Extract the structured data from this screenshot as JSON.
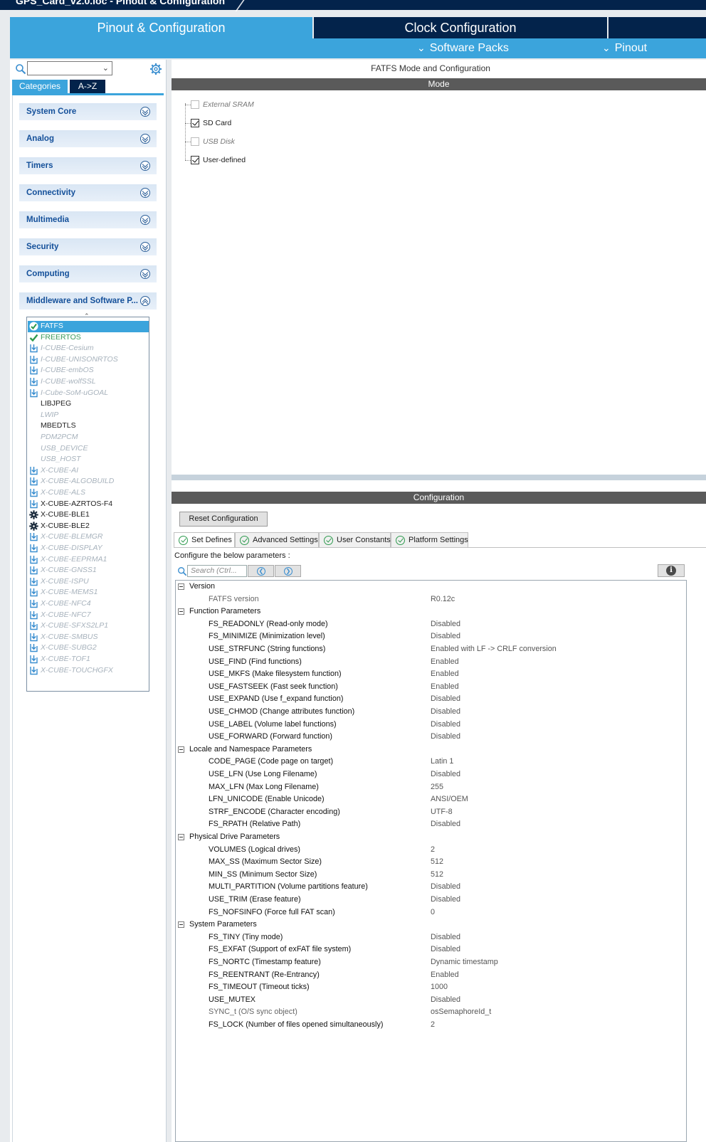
{
  "window": {
    "title": "GPS_Card_v2.0.ioc - Pinout & Configuration"
  },
  "top_tabs": {
    "pinout": "Pinout & Configuration",
    "clock": "Clock Configuration"
  },
  "sub_menu": {
    "software_packs": "Software Packs",
    "pinout": "Pinout"
  },
  "left_panel": {
    "search_value": "",
    "tabs": {
      "categories": "Categories",
      "az": "A->Z"
    },
    "categories": [
      "System Core",
      "Analog",
      "Timers",
      "Connectivity",
      "Multimedia",
      "Security",
      "Computing",
      "Middleware and Software P..."
    ],
    "middleware_items": [
      {
        "label": "FATFS",
        "state": "selected",
        "icon": "check-icon"
      },
      {
        "label": "FREERTOS",
        "state": "enabled",
        "icon": "check-icon"
      },
      {
        "label": "I-CUBE-Cesium",
        "state": "disabled",
        "icon": "download-icon"
      },
      {
        "label": "I-CUBE-UNISONRTOS",
        "state": "disabled",
        "icon": "download-icon"
      },
      {
        "label": "I-CUBE-embOS",
        "state": "disabled",
        "icon": "download-icon"
      },
      {
        "label": "I-CUBE-wolfSSL",
        "state": "disabled",
        "icon": "download-icon"
      },
      {
        "label": "I-Cube-SoM-uGOAL",
        "state": "disabled",
        "icon": "download-icon"
      },
      {
        "label": "LIBJPEG",
        "state": "normal",
        "icon": ""
      },
      {
        "label": "LWIP",
        "state": "disabled",
        "icon": ""
      },
      {
        "label": "MBEDTLS",
        "state": "normal",
        "icon": ""
      },
      {
        "label": "PDM2PCM",
        "state": "disabled",
        "icon": ""
      },
      {
        "label": "USB_DEVICE",
        "state": "disabled",
        "icon": ""
      },
      {
        "label": "USB_HOST",
        "state": "disabled",
        "icon": ""
      },
      {
        "label": "X-CUBE-AI",
        "state": "disabled",
        "icon": "download-icon"
      },
      {
        "label": "X-CUBE-ALGOBUILD",
        "state": "disabled",
        "icon": "download-icon"
      },
      {
        "label": "X-CUBE-ALS",
        "state": "disabled",
        "icon": "download-icon"
      },
      {
        "label": "X-CUBE-AZRTOS-F4",
        "state": "normal",
        "icon": "download-icon"
      },
      {
        "label": "X-CUBE-BLE1",
        "state": "normal",
        "icon": "gear-icon"
      },
      {
        "label": "X-CUBE-BLE2",
        "state": "normal",
        "icon": "gear-icon"
      },
      {
        "label": "X-CUBE-BLEMGR",
        "state": "disabled",
        "icon": "download-icon"
      },
      {
        "label": "X-CUBE-DISPLAY",
        "state": "disabled",
        "icon": "download-icon"
      },
      {
        "label": "X-CUBE-EEPRMA1",
        "state": "disabled",
        "icon": "download-icon"
      },
      {
        "label": "X-CUBE-GNSS1",
        "state": "disabled",
        "icon": "download-icon"
      },
      {
        "label": "X-CUBE-ISPU",
        "state": "disabled",
        "icon": "download-icon"
      },
      {
        "label": "X-CUBE-MEMS1",
        "state": "disabled",
        "icon": "download-icon"
      },
      {
        "label": "X-CUBE-NFC4",
        "state": "disabled",
        "icon": "download-icon"
      },
      {
        "label": "X-CUBE-NFC7",
        "state": "disabled",
        "icon": "download-icon"
      },
      {
        "label": "X-CUBE-SFXS2LP1",
        "state": "disabled",
        "icon": "download-icon"
      },
      {
        "label": "X-CUBE-SMBUS",
        "state": "disabled",
        "icon": "download-icon"
      },
      {
        "label": "X-CUBE-SUBG2",
        "state": "disabled",
        "icon": "download-icon"
      },
      {
        "label": "X-CUBE-TOF1",
        "state": "disabled",
        "icon": "download-icon"
      },
      {
        "label": "X-CUBE-TOUCHGFX",
        "state": "disabled",
        "icon": "download-icon"
      }
    ]
  },
  "mode_panel": {
    "title": "FATFS Mode and Configuration",
    "header": "Mode",
    "options": [
      {
        "label": "External SRAM",
        "checked": false,
        "enabled": false
      },
      {
        "label": "SD Card",
        "checked": true,
        "enabled": true
      },
      {
        "label": "USB Disk",
        "checked": false,
        "enabled": false
      },
      {
        "label": "User-defined",
        "checked": true,
        "enabled": true
      }
    ]
  },
  "config_panel": {
    "header": "Configuration",
    "reset_label": "Reset Configuration",
    "tabs": [
      "Set Defines",
      "Advanced Settings",
      "User Constants",
      "Platform Settings"
    ],
    "hint": "Configure the below parameters :",
    "search_placeholder": "Search (Ctrl...",
    "groups": [
      {
        "name": "Version",
        "params": [
          {
            "name": "FATFS version",
            "value": "R0.12c",
            "gray": true
          }
        ]
      },
      {
        "name": "Function Parameters",
        "params": [
          {
            "name": "FS_READONLY (Read-only mode)",
            "value": "Disabled"
          },
          {
            "name": "FS_MINIMIZE (Minimization level)",
            "value": "Disabled"
          },
          {
            "name": "USE_STRFUNC (String functions)",
            "value": "Enabled with LF -> CRLF conversion"
          },
          {
            "name": "USE_FIND (Find functions)",
            "value": "Enabled"
          },
          {
            "name": "USE_MKFS (Make filesystem function)",
            "value": "Enabled"
          },
          {
            "name": "USE_FASTSEEK (Fast seek function)",
            "value": "Enabled"
          },
          {
            "name": "USE_EXPAND (Use f_expand function)",
            "value": "Disabled"
          },
          {
            "name": "USE_CHMOD (Change attributes function)",
            "value": "Disabled"
          },
          {
            "name": "USE_LABEL (Volume label functions)",
            "value": "Disabled"
          },
          {
            "name": "USE_FORWARD (Forward function)",
            "value": "Disabled"
          }
        ]
      },
      {
        "name": "Locale and Namespace Parameters",
        "params": [
          {
            "name": "CODE_PAGE (Code page on target)",
            "value": "Latin 1"
          },
          {
            "name": "USE_LFN (Use Long Filename)",
            "value": "Disabled"
          },
          {
            "name": "MAX_LFN (Max Long Filename)",
            "value": "255"
          },
          {
            "name": "LFN_UNICODE (Enable Unicode)",
            "value": "ANSI/OEM"
          },
          {
            "name": "STRF_ENCODE (Character encoding)",
            "value": "UTF-8"
          },
          {
            "name": "FS_RPATH (Relative Path)",
            "value": "Disabled"
          }
        ]
      },
      {
        "name": "Physical Drive Parameters",
        "params": [
          {
            "name": "VOLUMES (Logical drives)",
            "value": "2"
          },
          {
            "name": "MAX_SS (Maximum Sector Size)",
            "value": "512"
          },
          {
            "name": "MIN_SS (Minimum Sector Size)",
            "value": "512"
          },
          {
            "name": "MULTI_PARTITION (Volume partitions feature)",
            "value": "Disabled"
          },
          {
            "name": "USE_TRIM (Erase feature)",
            "value": "Disabled"
          },
          {
            "name": "FS_NOFSINFO (Force full FAT scan)",
            "value": "0"
          }
        ]
      },
      {
        "name": "System Parameters",
        "params": [
          {
            "name": "FS_TINY (Tiny mode)",
            "value": "Disabled"
          },
          {
            "name": "FS_EXFAT (Support of exFAT file system)",
            "value": "Disabled"
          },
          {
            "name": "FS_NORTC (Timestamp feature)",
            "value": "Dynamic timestamp"
          },
          {
            "name": "FS_REENTRANT (Re-Entrancy)",
            "value": "Enabled"
          },
          {
            "name": "FS_TIMEOUT (Timeout ticks)",
            "value": "1000"
          },
          {
            "name": "USE_MUTEX",
            "value": "Disabled"
          },
          {
            "name": "SYNC_t (O/S sync object)",
            "value": "osSemaphoreId_t",
            "gray": true
          },
          {
            "name": "FS_LOCK (Number of files opened simultaneously)",
            "value": "2"
          }
        ]
      }
    ]
  }
}
